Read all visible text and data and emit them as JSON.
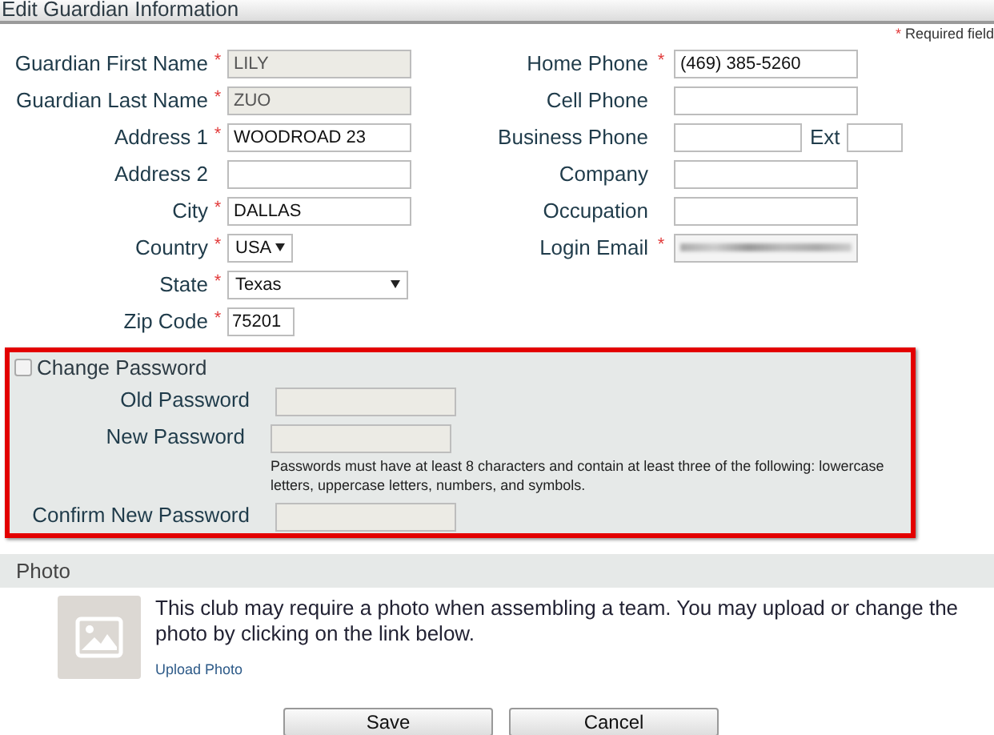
{
  "window": {
    "title": "Edit Guardian Information"
  },
  "required_note": {
    "mark": "*",
    "text": "Required field"
  },
  "left_fields": [
    {
      "kind": "text",
      "label": "Guardian First Name",
      "required": true,
      "value": "LILY",
      "disabled": true
    },
    {
      "kind": "text",
      "label": "Guardian Last Name",
      "required": true,
      "value": "ZUO",
      "disabled": true
    },
    {
      "kind": "text",
      "label": "Address 1",
      "required": true,
      "value": "WOODROAD 23",
      "disabled": false
    },
    {
      "kind": "text",
      "label": "Address 2",
      "required": false,
      "disabled": false
    },
    {
      "kind": "text",
      "label": "City",
      "required": true,
      "value": "DALLAS",
      "disabled": false
    },
    {
      "kind": "select",
      "label": "Country",
      "required": true,
      "value": "USA"
    },
    {
      "kind": "select",
      "label": "State",
      "required": true,
      "value": "Texas"
    },
    {
      "kind": "text",
      "label": "Zip Code",
      "required": true,
      "value": "75201",
      "disabled": false
    }
  ],
  "right_fields": [
    {
      "kind": "text",
      "label": "Home Phone",
      "required": true,
      "value": "(469) 385-5260",
      "disabled": false
    },
    {
      "kind": "text",
      "label": "Cell Phone",
      "required": false,
      "disabled": false
    },
    {
      "kind": "phone_ext",
      "label": "Business Phone",
      "required": false,
      "ext_label": "Ext"
    },
    {
      "kind": "text",
      "label": "Company",
      "required": false,
      "disabled": false
    },
    {
      "kind": "text",
      "label": "Occupation",
      "required": false,
      "disabled": false
    },
    {
      "kind": "blurred",
      "label": "Login Email",
      "required": true
    }
  ],
  "password_section": {
    "checkbox_label": "Change Password",
    "checked": false,
    "fields": [
      {
        "label": "Old Password",
        "disabled": true
      },
      {
        "label": "New Password",
        "disabled": true,
        "hint": "Passwords must have at least 8 characters and contain at least three of the following: lowercase letters, uppercase letters, numbers, and symbols."
      },
      {
        "label": "Confirm New Password",
        "disabled": true
      }
    ]
  },
  "photo_section": {
    "title": "Photo",
    "text": "This club may require a photo when assembling a team. You may upload or change the photo by clicking on the link below.",
    "link": "Upload Photo"
  },
  "buttons": [
    {
      "label": "Save"
    },
    {
      "label": "Cancel"
    }
  ]
}
